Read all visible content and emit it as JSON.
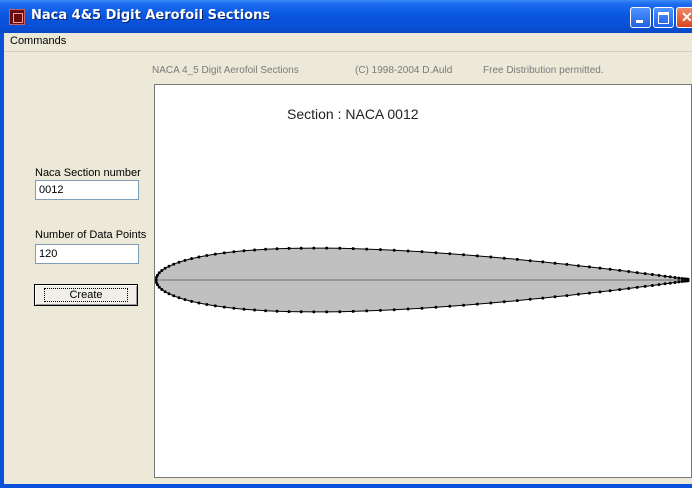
{
  "window": {
    "title": "Naca 4&5 Digit Aerofoil Sections"
  },
  "menu": {
    "commands": "Commands"
  },
  "info": {
    "app_name": "NACA 4_5  Digit Aerofoil Sections",
    "copyright": "(C) 1998-2004  D.Auld",
    "distribution": "Free Distribution permitted."
  },
  "form": {
    "section_label": "Naca Section number",
    "section_value": "0012",
    "points_label": "Number of Data Points",
    "points_value": "120",
    "create_label": "Create"
  },
  "plot": {
    "title": "Section : NACA 0012",
    "naca_thickness": 0.12,
    "data_points": 120,
    "fill": "#c0c0c0",
    "stroke": "#000000"
  }
}
